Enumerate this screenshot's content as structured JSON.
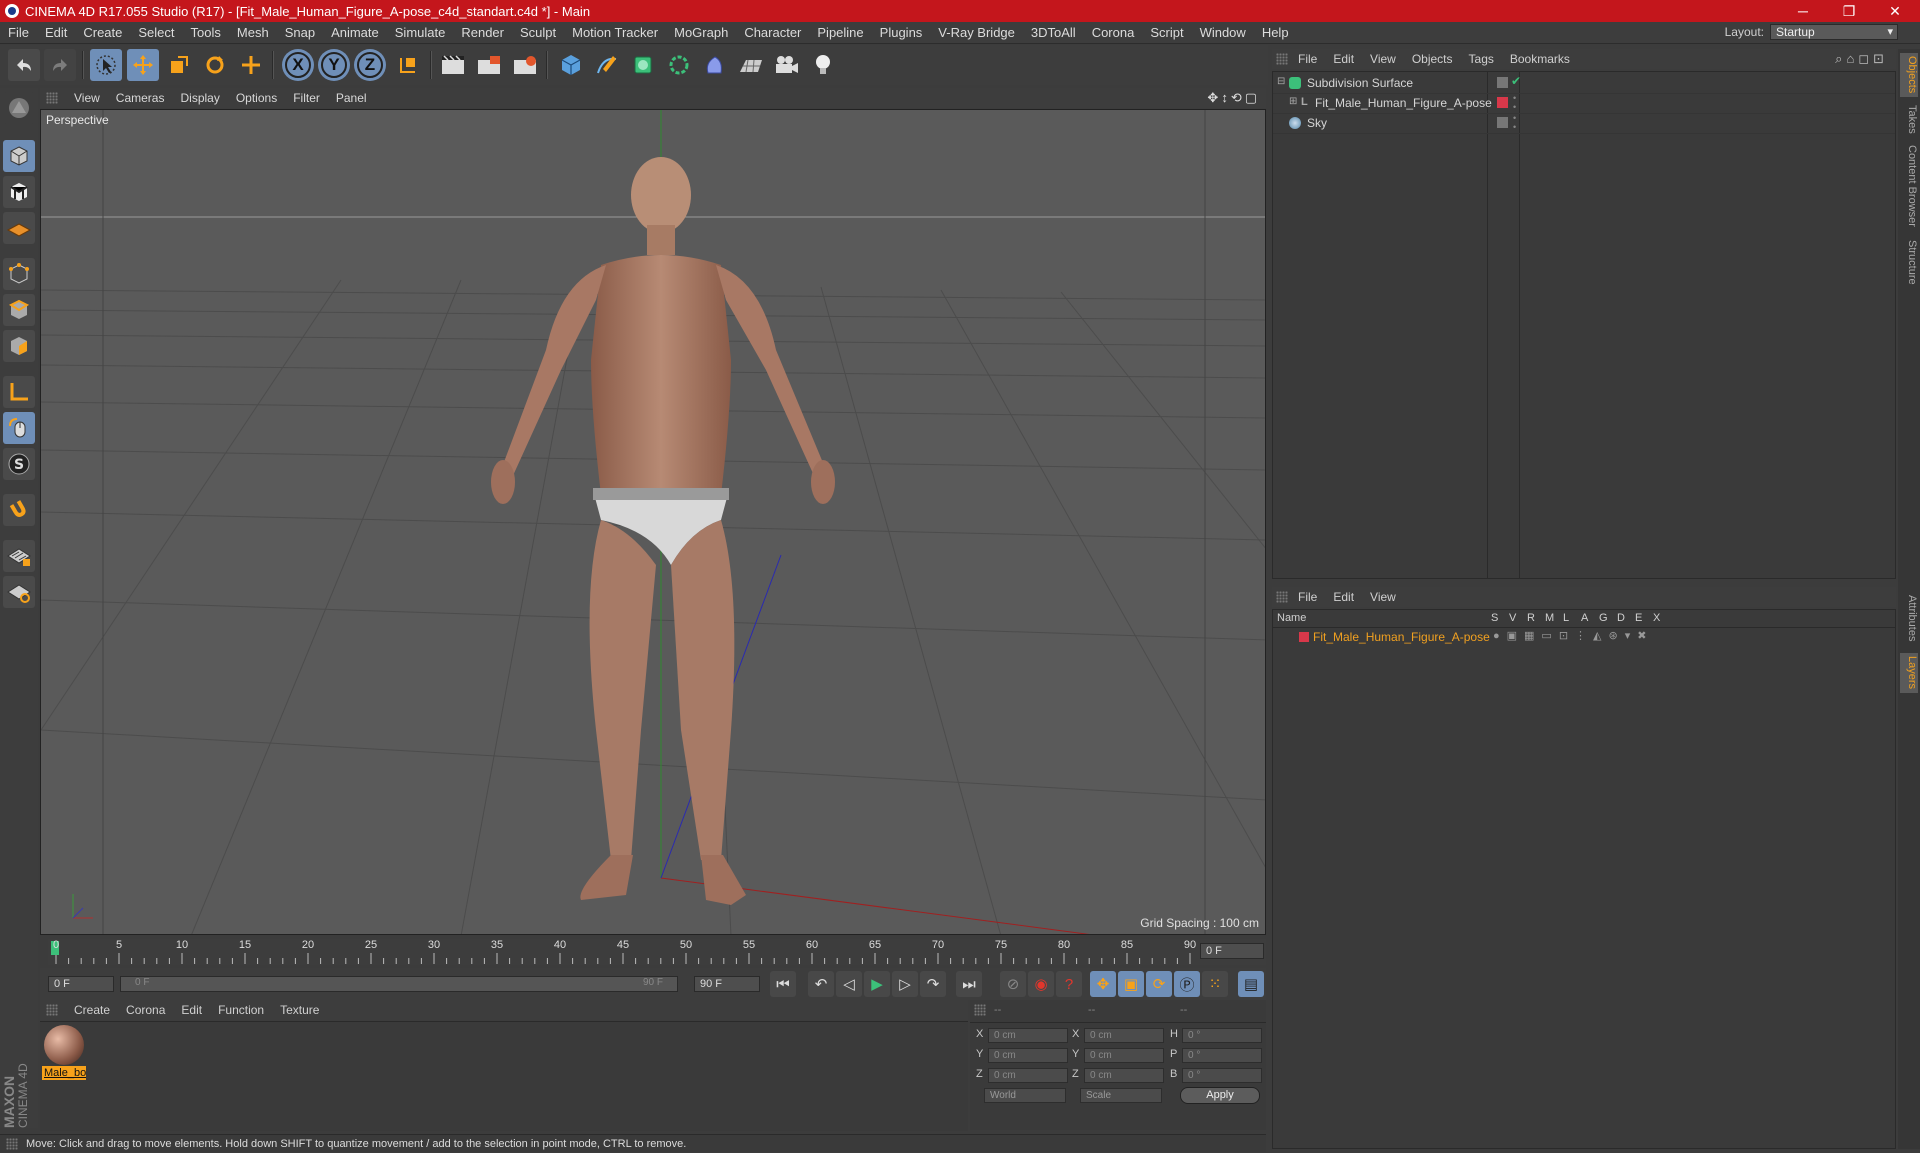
{
  "window": {
    "title": "CINEMA 4D R17.055 Studio (R17) - [Fit_Male_Human_Figure_A-pose_c4d_standart.c4d *] - Main",
    "minimize": "─",
    "restore": "❐",
    "close": "✕"
  },
  "menubar": {
    "items": [
      "File",
      "Edit",
      "Create",
      "Select",
      "Tools",
      "Mesh",
      "Snap",
      "Animate",
      "Simulate",
      "Render",
      "Sculpt",
      "Motion Tracker",
      "MoGraph",
      "Character",
      "Pipeline",
      "Plugins",
      "V-Ray Bridge",
      "3DToAll",
      "Corona",
      "Script",
      "Window",
      "Help"
    ],
    "layout_label": "Layout:",
    "layout_value": "Startup"
  },
  "toolbar": {
    "axis_x": "X",
    "axis_y": "Y",
    "axis_z": "Z"
  },
  "viewport": {
    "menu": [
      "View",
      "Cameras",
      "Display",
      "Options",
      "Filter",
      "Panel"
    ],
    "label": "Perspective",
    "grid_spacing": "Grid Spacing : 100 cm"
  },
  "timeline": {
    "ticks": [
      "0",
      "5",
      "10",
      "15",
      "20",
      "25",
      "30",
      "35",
      "40",
      "45",
      "50",
      "55",
      "60",
      "65",
      "70",
      "75",
      "80",
      "85",
      "90"
    ],
    "current_frame": "0 F",
    "start_frame": "0 F",
    "range_start": "0 F",
    "range_end": "90 F",
    "end_frame": "90 F"
  },
  "material_manager": {
    "menu": [
      "Create",
      "Corona",
      "Edit",
      "Function",
      "Texture"
    ],
    "material_name": "Male_bo"
  },
  "coordinates": {
    "header": [
      "--",
      "--",
      "--"
    ],
    "rows": [
      {
        "a": "X",
        "av": "0 cm",
        "b": "X",
        "bv": "0 cm",
        "c": "H",
        "cv": "0 °"
      },
      {
        "a": "Y",
        "av": "0 cm",
        "b": "Y",
        "bv": "0 cm",
        "c": "P",
        "cv": "0 °"
      },
      {
        "a": "Z",
        "av": "0 cm",
        "b": "Z",
        "bv": "0 cm",
        "c": "B",
        "cv": "0 °"
      }
    ],
    "world": "World",
    "scale": "Scale",
    "apply": "Apply"
  },
  "object_manager": {
    "menu": [
      "File",
      "Edit",
      "View",
      "Objects",
      "Tags",
      "Bookmarks"
    ],
    "objects": [
      "Subdivision Surface",
      "Fit_Male_Human_Figure_A-pose",
      "Sky"
    ]
  },
  "layer_manager": {
    "menu": [
      "File",
      "Edit",
      "View"
    ],
    "col_name": "Name",
    "cols": [
      "S",
      "V",
      "R",
      "M",
      "L",
      "A",
      "G",
      "D",
      "E",
      "X"
    ],
    "layer": "Fit_Male_Human_Figure_A-pose",
    "layer_color": "#d8384a"
  },
  "right_tabs": [
    "Objects",
    "Takes",
    "Content Browser",
    "Structure",
    "Attributes",
    "Layers"
  ],
  "status": "Move: Click and drag to move elements. Hold down SHIFT to quantize movement / add to the selection in point mode, CTRL to remove.",
  "brand": {
    "line1": "MAXON",
    "line2": "CINEMA 4D"
  },
  "colors": {
    "accent": "#c4161c",
    "active": "#6f8fb8",
    "layer_text": "#f0a020"
  }
}
